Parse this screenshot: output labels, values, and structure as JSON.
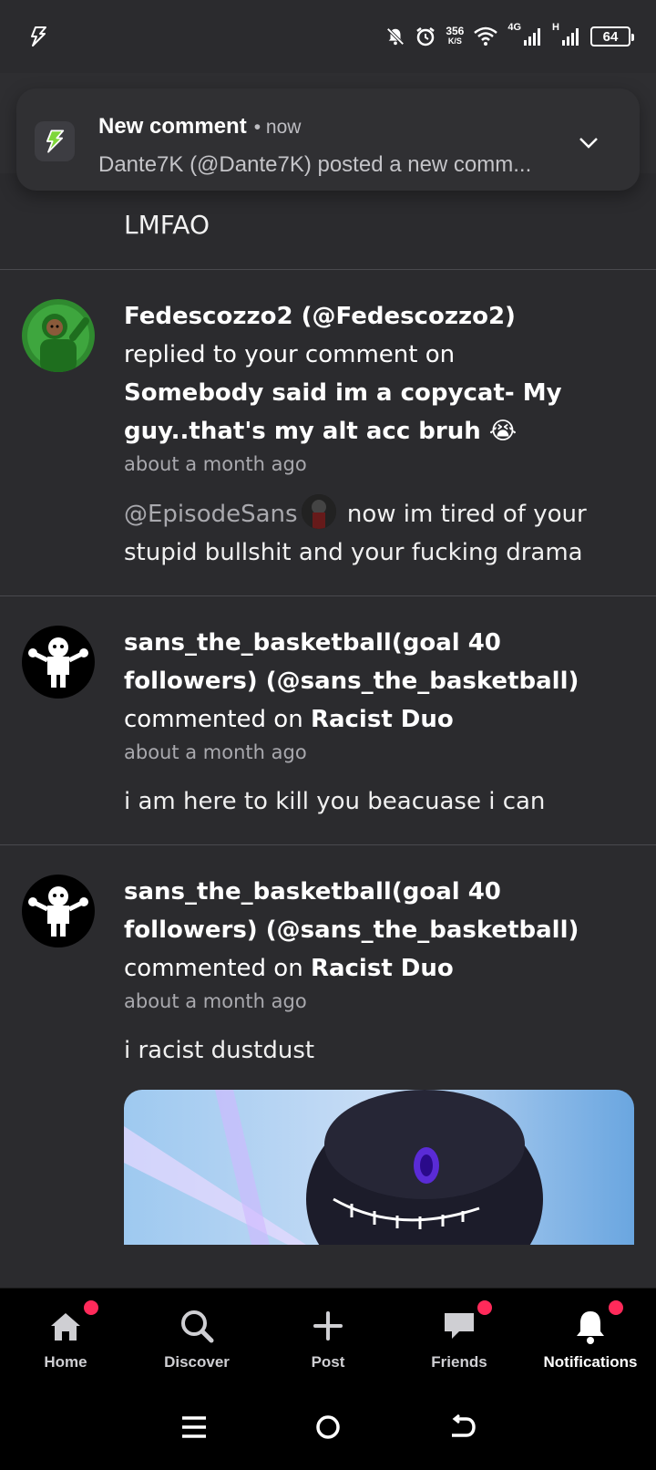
{
  "status_bar": {
    "speed_value": "356",
    "speed_unit": "K/S",
    "network": "4G",
    "network2": "H",
    "battery": "64"
  },
  "toast": {
    "title": "New comment",
    "time": "• now",
    "text": "Dante7K (@Dante7K) posted a new comm..."
  },
  "feed": {
    "top_text": "LMFAO",
    "items": [
      {
        "user": "Fedescozzo2 (@Fedescozzo2)",
        "action": "replied to your comment on",
        "target": "Somebody said im a copycat- My guy..that's my alt acc bruh 😭",
        "time": "about a month ago",
        "mention": "@EpisodeSans",
        "body": " now im tired of your stupid bullshit and your fucking drama"
      },
      {
        "user": "sans_the_basketball(goal 40 followers) (@sans_the_basketball)",
        "action": "commented on",
        "target": "Racist Duo",
        "time": "about a month ago",
        "body": "i am here to kill you beacuase i can"
      },
      {
        "user": "sans_the_basketball(goal 40 followers) (@sans_the_basketball)",
        "action": "commented on",
        "target": "Racist Duo",
        "time": "about a month ago",
        "body": "i racist dustdust"
      }
    ]
  },
  "bottom_nav": [
    {
      "label": "Home",
      "icon": "home-icon",
      "badge": true
    },
    {
      "label": "Discover",
      "icon": "search-icon",
      "badge": false
    },
    {
      "label": "Post",
      "icon": "plus-icon",
      "badge": false
    },
    {
      "label": "Friends",
      "icon": "chat-icon",
      "badge": true
    },
    {
      "label": "Notifications",
      "icon": "bell-icon",
      "badge": true
    }
  ],
  "colors": {
    "background": "#2b2b2e",
    "badge": "#ff2a5a",
    "nav_bg": "#000000"
  }
}
